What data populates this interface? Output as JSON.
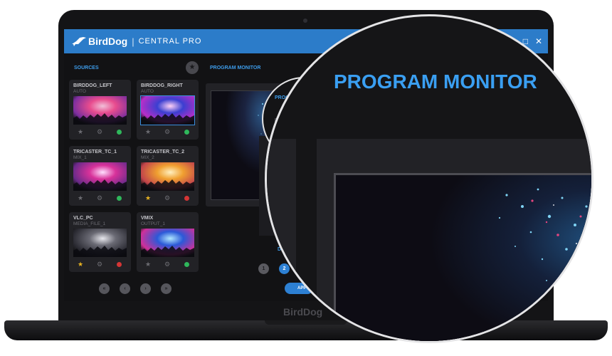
{
  "app": {
    "brand": "BirdDog",
    "separator": "|",
    "product": "CENTRAL PRO",
    "bezel_brand": "BirdDog"
  },
  "window_controls": {
    "maximize": "□",
    "close": "✕"
  },
  "sidebar": {
    "sources_label": "SOURCES",
    "favorites_icon": "★",
    "sources": [
      {
        "name": "BIRDDOG_LEFT",
        "sub": "AUTO",
        "favorite": false,
        "status": "online",
        "selected": false
      },
      {
        "name": "BIRDDOG_RIGHT",
        "sub": "AUTO",
        "favorite": false,
        "status": "online",
        "selected": true
      },
      {
        "name": "TRICASTER_TC_1",
        "sub": "MIX_1",
        "favorite": false,
        "status": "online",
        "selected": false
      },
      {
        "name": "TRICASTER_TC_2",
        "sub": "MIX_2",
        "favorite": true,
        "status": "offline",
        "selected": false
      },
      {
        "name": "VLC_PC",
        "sub": "MEDIA_FILE_1",
        "favorite": true,
        "status": "offline",
        "selected": false
      },
      {
        "name": "VMIX",
        "sub": "OUTPUT_1",
        "favorite": false,
        "status": "online",
        "selected": false
      }
    ],
    "pagination": [
      "«",
      "‹",
      "›",
      "»"
    ]
  },
  "main": {
    "program_monitor_label": "PROGRAM MONITOR",
    "side_label": "D",
    "pages": [
      "1",
      "2"
    ],
    "active_page": "2",
    "apply_label": "APP"
  },
  "magnifier": {
    "title": "PROGRAM MONITOR"
  },
  "colors": {
    "accent": "#2c7cc9",
    "online": "#2fb75b",
    "offline": "#d43535",
    "favorite": "#e8b321"
  }
}
